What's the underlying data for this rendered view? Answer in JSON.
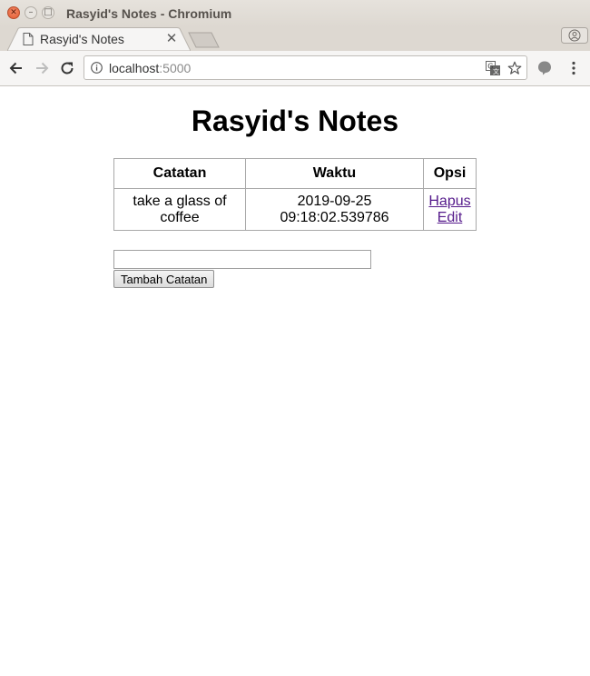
{
  "window": {
    "title": "Rasyid's Notes - Chromium",
    "controls": {
      "close_glyph": "✕",
      "minimize_glyph": "–",
      "maximize_glyph": "□"
    }
  },
  "tab": {
    "title": "Rasyid's Notes",
    "close_glyph": "✕",
    "icon": "page-icon"
  },
  "toolbar": {
    "url_host": "localhost",
    "url_port": ":5000",
    "icons": [
      "back-arrow-icon",
      "forward-arrow-icon",
      "reload-icon",
      "info-icon",
      "translate-icon",
      "star-icon",
      "extension-icon",
      "menu-icon"
    ]
  },
  "page": {
    "heading": "Rasyid's Notes",
    "table": {
      "headers": {
        "note": "Catatan",
        "time": "Waktu",
        "options": "Opsi"
      },
      "rows": [
        {
          "note_line1": "take a glass of",
          "note_line2": "coffee",
          "time_line1": "2019-09-25",
          "time_line2": "09:18:02.539786",
          "delete_label": "Hapus",
          "edit_label": "Edit"
        }
      ]
    },
    "form": {
      "input_value": "",
      "submit_label": "Tambah Catatan"
    }
  },
  "colors": {
    "link_visited": "#551a8b",
    "titlebar": "#dfdad3",
    "close_button": "#e25a2e"
  }
}
